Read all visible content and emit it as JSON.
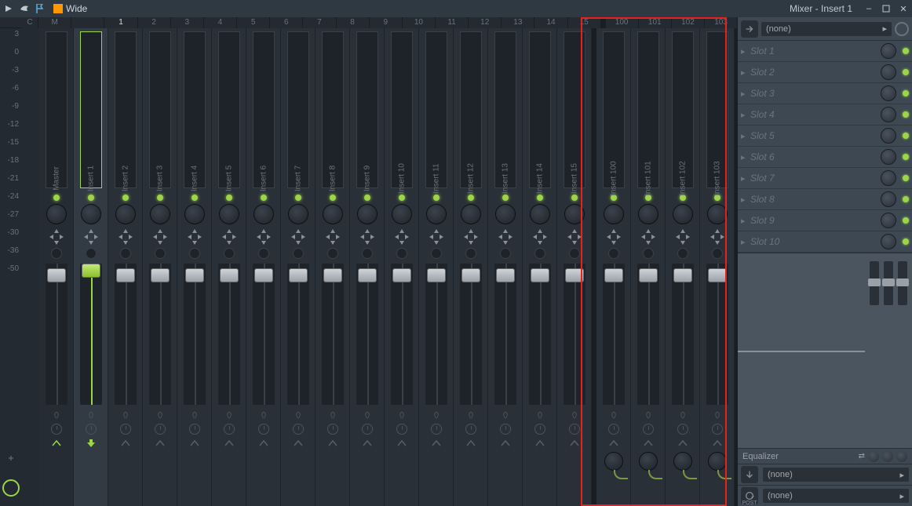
{
  "window": {
    "title": "Mixer - Insert 1",
    "preset": "Wide"
  },
  "ruler_ticks": [
    "3",
    "0",
    "-3",
    "-6",
    "-9",
    "-12",
    "-15",
    "-18",
    "-21",
    "-24",
    "-27",
    "-30",
    "-36",
    "-50"
  ],
  "header_left": [
    "C",
    "M"
  ],
  "tracks_main": [
    {
      "num": "",
      "label": "Master",
      "type": "master"
    },
    {
      "num": "1",
      "label": "Insert 1",
      "type": "selected"
    },
    {
      "num": "2",
      "label": "Insert 2"
    },
    {
      "num": "3",
      "label": "Insert 3"
    },
    {
      "num": "4",
      "label": "Insert 4"
    },
    {
      "num": "5",
      "label": "Insert 5"
    },
    {
      "num": "6",
      "label": "Insert 6"
    },
    {
      "num": "7",
      "label": "Insert 7"
    },
    {
      "num": "8",
      "label": "Insert 8"
    },
    {
      "num": "9",
      "label": "Insert 9"
    },
    {
      "num": "10",
      "label": "Insert 10"
    },
    {
      "num": "11",
      "label": "Insert 11"
    },
    {
      "num": "12",
      "label": "Insert 12"
    },
    {
      "num": "13",
      "label": "Insert 13"
    },
    {
      "num": "14",
      "label": "Insert 14"
    },
    {
      "num": "15",
      "label": "Insert 15"
    }
  ],
  "tracks_right": [
    {
      "num": "100",
      "label": "Insert 100"
    },
    {
      "num": "101",
      "label": "Insert 101"
    },
    {
      "num": "102",
      "label": "Insert 102"
    },
    {
      "num": "103",
      "label": "Insert 103"
    }
  ],
  "slots": [
    "Slot 1",
    "Slot 2",
    "Slot 3",
    "Slot 4",
    "Slot 5",
    "Slot 6",
    "Slot 7",
    "Slot 8",
    "Slot 9",
    "Slot 10"
  ],
  "input_label": "(none)",
  "output_labels": [
    "(none)",
    "(none)"
  ],
  "eq_title": "Equalizer",
  "post_label": "POST",
  "accent": "#9bd646"
}
